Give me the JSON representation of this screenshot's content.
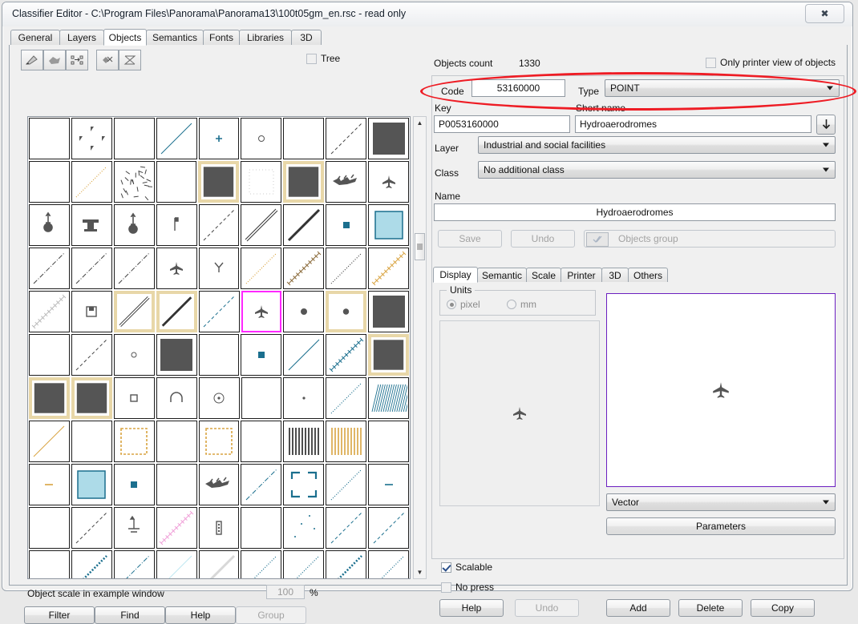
{
  "window": {
    "title": "Classifier Editor - C:\\Program Files\\Panorama\\Panorama13\\100t05gm_en.rsc - read only",
    "close_label": "✖"
  },
  "tabs": [
    {
      "label": "General",
      "active": false
    },
    {
      "label": "Layers",
      "active": false
    },
    {
      "label": "Objects",
      "active": true
    },
    {
      "label": "Semantics",
      "active": false
    },
    {
      "label": "Fonts",
      "active": false
    },
    {
      "label": "Libraries",
      "active": false
    },
    {
      "label": "3D",
      "active": false
    }
  ],
  "left": {
    "tree_checkbox_label": "Tree",
    "tree_checked": false,
    "scale_label": "Object scale in example window",
    "scale_value": "100",
    "percent": "%",
    "buttons": [
      {
        "label": "Filter",
        "disabled": false
      },
      {
        "label": "Find",
        "disabled": false
      },
      {
        "label": "Help",
        "disabled": false
      },
      {
        "label": "Group",
        "disabled": true
      }
    ]
  },
  "right": {
    "objects_count_label": "Objects count",
    "objects_count_value": "1330",
    "printer_view_label": "Only printer view of objects",
    "printer_view_checked": false,
    "code_label": "Code",
    "code_value": "53160000",
    "type_label": "Type",
    "type_value": "POINT",
    "key_label": "Key",
    "key_value": "P0053160000",
    "short_name_label": "Short name",
    "short_name_value": "Hydroaerodromes",
    "layer_label": "Layer",
    "layer_value": "Industrial and social facilities",
    "class_label": "Class",
    "class_value": "No additional class",
    "name_label": "Name",
    "name_value": "Hydroaerodromes",
    "save_label": "Save",
    "undo_label": "Undo",
    "objects_group_label": "Objects group"
  },
  "inner_tabs": [
    {
      "label": "Display",
      "active": true
    },
    {
      "label": "Semantic",
      "active": false
    },
    {
      "label": "Scale",
      "active": false
    },
    {
      "label": "Printer",
      "active": false
    },
    {
      "label": "3D",
      "active": false
    },
    {
      "label": "Others",
      "active": false
    }
  ],
  "display": {
    "units_title": "Units",
    "unit_pixel": "pixel",
    "unit_mm": "mm",
    "unit_selected": "pixel",
    "vector_value": "Vector",
    "parameters_label": "Parameters",
    "scalable_label": "Scalable",
    "scalable_checked": true,
    "no_press_label": "No press",
    "no_press_checked": false,
    "buttons": [
      {
        "label": "Help",
        "disabled": false
      },
      {
        "label": "Undo",
        "disabled": true
      },
      {
        "label": "Add",
        "disabled": false
      },
      {
        "label": "Delete",
        "disabled": false
      },
      {
        "label": "Copy",
        "disabled": false
      }
    ]
  },
  "colors": {
    "selection_border": "#ff28ff",
    "highlight_border": "#e8d7a8",
    "annotation": "#ee1c24",
    "preview_border": "#6b20c0",
    "teal": "#1b6f8e",
    "light_blue": "#addbe8",
    "tan": "#d9a441",
    "dark_fill": "#555555"
  },
  "grid": {
    "columns": 9,
    "rows": 11,
    "cells": [
      [
        {
          "k": "blank"
        },
        {
          "k": "dots4"
        },
        {
          "k": "blank"
        },
        {
          "k": "line",
          "c": "#1b6f8e",
          "s": "solid"
        },
        {
          "k": "plus",
          "c": "#1b6f8e"
        },
        {
          "k": "circle"
        },
        {
          "k": "blank"
        },
        {
          "k": "line",
          "c": "#444",
          "s": "dash"
        },
        {
          "k": "fill",
          "c": "#555"
        }
      ],
      [
        {
          "k": "blank"
        },
        {
          "k": "line",
          "c": "#d9a441",
          "s": "dot"
        },
        {
          "k": "scatter"
        },
        {
          "k": "blank"
        },
        {
          "k": "fill",
          "c": "#555",
          "hl": true
        },
        {
          "k": "dotsq"
        },
        {
          "k": "fill",
          "c": "#555",
          "hl": true
        },
        {
          "k": "plane2"
        },
        {
          "k": "plane"
        }
      ],
      [
        {
          "k": "tower"
        },
        {
          "k": "anvil"
        },
        {
          "k": "tower2"
        },
        {
          "k": "post"
        },
        {
          "k": "line",
          "c": "#444",
          "s": "dash"
        },
        {
          "k": "line",
          "c": "#333",
          "s": "double"
        },
        {
          "k": "line",
          "c": "#333",
          "s": "thick"
        },
        {
          "k": "sq",
          "c": "#1b6f8e"
        },
        {
          "k": "fillsq",
          "c": "#addbe8"
        }
      ],
      [
        {
          "k": "line",
          "c": "#444",
          "s": "dashdot"
        },
        {
          "k": "line",
          "c": "#444",
          "s": "dashdot"
        },
        {
          "k": "line",
          "c": "#444",
          "s": "dashdot"
        },
        {
          "k": "plane"
        },
        {
          "k": "fork"
        },
        {
          "k": "line",
          "c": "#d9a441",
          "s": "dot"
        },
        {
          "k": "line",
          "c": "#8a6a3a",
          "s": "ladder"
        },
        {
          "k": "line",
          "c": "#444",
          "s": "dot"
        },
        {
          "k": "line",
          "c": "#d9a441",
          "s": "ladder"
        }
      ],
      [
        {
          "k": "line",
          "c": "#bbb",
          "s": "ladder"
        },
        {
          "k": "flagbox"
        },
        {
          "k": "line",
          "c": "#333",
          "s": "double",
          "hl": true
        },
        {
          "k": "line",
          "c": "#333",
          "s": "thick",
          "hl": true
        },
        {
          "k": "line",
          "c": "#1b6f8e",
          "s": "dash"
        },
        {
          "k": "plane",
          "sel": true
        },
        {
          "k": "dot",
          "c": "#555"
        },
        {
          "k": "dot",
          "c": "#555",
          "hl": true
        },
        {
          "k": "fill",
          "c": "#555"
        }
      ],
      [
        {
          "k": "blank"
        },
        {
          "k": "line",
          "c": "#444",
          "s": "dash"
        },
        {
          "k": "ring"
        },
        {
          "k": "fill",
          "c": "#555"
        },
        {
          "k": "blank"
        },
        {
          "k": "sq",
          "c": "#1b6f8e"
        },
        {
          "k": "line",
          "c": "#1b6f8e",
          "s": "solid"
        },
        {
          "k": "line",
          "c": "#1b6f8e",
          "s": "ladder"
        },
        {
          "k": "fill",
          "c": "#555",
          "hl": true
        }
      ],
      [
        {
          "k": "fill",
          "c": "#555",
          "hl": true
        },
        {
          "k": "fill",
          "c": "#555",
          "hl": true
        },
        {
          "k": "smallsq"
        },
        {
          "k": "arch"
        },
        {
          "k": "target"
        },
        {
          "k": "blank"
        },
        {
          "k": "tinydot"
        },
        {
          "k": "line",
          "c": "#1b6f8e",
          "s": "dot"
        },
        {
          "k": "hatch",
          "c": "#1b6f8e"
        }
      ],
      [
        {
          "k": "line",
          "c": "#d9a441",
          "s": "solid"
        },
        {
          "k": "blank"
        },
        {
          "k": "dashbox",
          "c": "#d9a441"
        },
        {
          "k": "blank"
        },
        {
          "k": "dashbox",
          "c": "#d9a441"
        },
        {
          "k": "blank"
        },
        {
          "k": "vbars",
          "c": "#222"
        },
        {
          "k": "vbars",
          "c": "#d9a441"
        },
        {
          "k": "blank"
        }
      ],
      [
        {
          "k": "tick",
          "c": "#d9a441"
        },
        {
          "k": "fillsq",
          "c": "#addbe8"
        },
        {
          "k": "sq",
          "c": "#1b6f8e"
        },
        {
          "k": "blank"
        },
        {
          "k": "plane2"
        },
        {
          "k": "line",
          "c": "#1b6f8e",
          "s": "dashdot"
        },
        {
          "k": "cornerbox",
          "c": "#1b6f8e"
        },
        {
          "k": "line",
          "c": "#1b6f8e",
          "s": "dot"
        },
        {
          "k": "tick",
          "c": "#1b6f8e"
        }
      ],
      [
        {
          "k": "blank"
        },
        {
          "k": "line",
          "c": "#444",
          "s": "dash"
        },
        {
          "k": "mast"
        },
        {
          "k": "line",
          "c": "#f0a0d8",
          "s": "ladder"
        },
        {
          "k": "domino"
        },
        {
          "k": "blank"
        },
        {
          "k": "sparse"
        },
        {
          "k": "line",
          "c": "#1b6f8e",
          "s": "dash"
        },
        {
          "k": "line",
          "c": "#1b6f8e",
          "s": "dash"
        }
      ],
      [
        {
          "k": "blank"
        },
        {
          "k": "line",
          "c": "#1b6f8e",
          "s": "thickdot"
        },
        {
          "k": "line",
          "c": "#1b6f8e",
          "s": "dashdot"
        },
        {
          "k": "line",
          "c": "#bfe8f2",
          "s": "solid"
        },
        {
          "k": "line",
          "c": "#d8d8d8",
          "s": "thick"
        },
        {
          "k": "line",
          "c": "#1b6f8e",
          "s": "dot"
        },
        {
          "k": "line",
          "c": "#1b6f8e",
          "s": "dot"
        },
        {
          "k": "line",
          "c": "#1b6f8e",
          "s": "thickdot"
        },
        {
          "k": "line",
          "c": "#1b6f8e",
          "s": "dot"
        }
      ]
    ]
  }
}
